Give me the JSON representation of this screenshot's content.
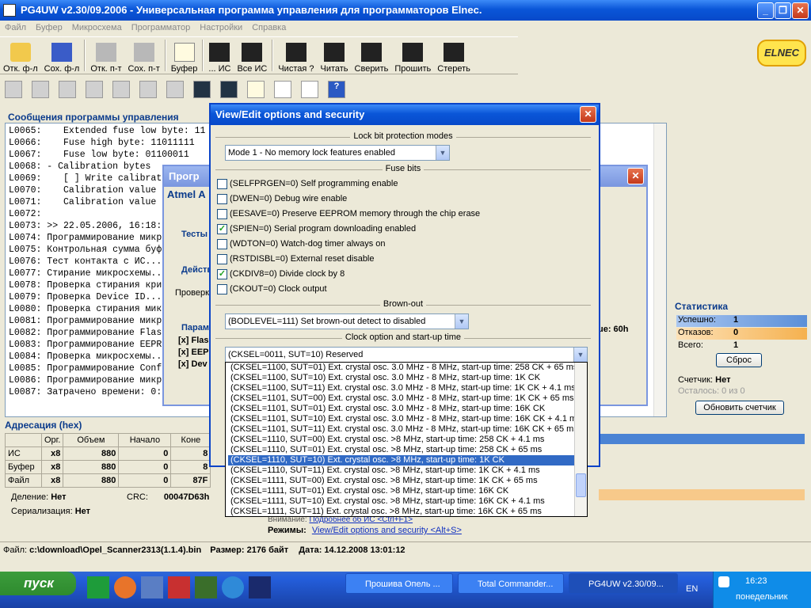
{
  "app": {
    "title": "PG4UW v2.30/09.2006 - Универсальная программа управления для программаторов Elnec.",
    "logo": "ELNEC"
  },
  "menu": [
    "Файл",
    "Буфер",
    "Микросхема",
    "Программатор",
    "Настройки",
    "Справка"
  ],
  "toolbar": [
    "Отк. ф-л",
    "Сох. ф-л",
    "Отк. п-т",
    "Сох. п-т",
    "Буфер",
    "... ИС",
    "Все ИС",
    "Чистая ?",
    "Читать",
    "Сверить",
    "Прошить",
    "Стереть"
  ],
  "log_panel": {
    "title": "Сообщения программы управления",
    "lines": [
      "L0065:    Extended fuse low byte: 11",
      "L0066:    Fuse high byte: 11011111",
      "L0067:    Fuse low byte: 01100011",
      "L0068: - Calibration bytes",
      "L0069:    [ ] Write calibrat",
      "L0070:    Calibration value",
      "L0071:    Calibration value",
      "L0072:",
      "L0073: >> 22.05.2006, 16:18:",
      "L0074: Программирование микр",
      "L0075: Контрольная сумма буф",
      "L0076: Тест контакта с ИС...",
      "L0077: Стирание микросхемы..",
      "L0078: Проверка стирания кри",
      "L0079: Проверка Device ID...",
      "L0080: Проверка стирания микр",
      "L0081: Программирование микр",
      "L0082: Программирование Flas",
      "L0083: Программирование EEPR",
      "L0084: Проверка микросхемы..",
      "L0085: Программирование Conf",
      "L0086: Программирование микр",
      "L0087: Затрачено времени: 0:"
    ]
  },
  "back_dialog": {
    "title": "Прогр",
    "header": "Atmel A",
    "group1": "Тесты",
    "group2": "Действ",
    "text": "Проверк",
    "group3": "Парам",
    "items": [
      "[x] Flas",
      "[x] EEP",
      "[x] Dev"
    ],
    "right_text": "ue: 60h"
  },
  "address": {
    "title": "Адресация (hex)",
    "headers": [
      "",
      "Орг.",
      "Объем",
      "Начало",
      "Коне"
    ],
    "rows": [
      [
        "ИС",
        "x8",
        "880",
        "0",
        "8"
      ],
      [
        "Буфер",
        "x8",
        "880",
        "0",
        "8"
      ],
      [
        "Файл",
        "x8",
        "880",
        "0",
        "87F"
      ]
    ],
    "division_label": "Деление:",
    "division": "Нет",
    "crc_label": "CRC:",
    "crc": "00047D63h",
    "serial_label": "Сериализация:",
    "serial": "Нет"
  },
  "stats": {
    "title": "Статистика",
    "success_label": "Успешно:",
    "success": "1",
    "fail_label": "Отказов:",
    "fail": "0",
    "total_label": "Всего:",
    "total": "1",
    "reset": "Сброс",
    "counter_label": "Счетчик:",
    "counter": "Нет",
    "remain_label": "Осталось:",
    "remain": "0 из 0",
    "update": "Обновить счетчик"
  },
  "bottom_info": {
    "attention": "Внимание:",
    "attention_link": "Подробнее об ИС <Ctrl+F1>",
    "modes": "Режимы:",
    "modes_link": "View/Edit options and security <Alt+S>"
  },
  "status": {
    "file_label": "Файл:",
    "file": "c:\\download\\Opel_Scanner2313(1.1.4).bin",
    "size": "Размер: 2176 байт",
    "date": "Дата: 14.12.2008 13:01:12"
  },
  "dialog": {
    "title": "View/Edit options and security",
    "lock_title": "Lock bit protection modes",
    "lock_value": "Mode 1 - No memory lock features enabled",
    "fuse_title": "Fuse bits",
    "fuses": [
      {
        "label": "(SELFPRGEN=0) Self programming enable",
        "checked": false
      },
      {
        "label": "(DWEN=0) Debug wire enable",
        "checked": false
      },
      {
        "label": "(EESAVE=0) Preserve EEPROM memory through the chip erase",
        "checked": false
      },
      {
        "label": "(SPIEN=0) Serial program downloading enabled",
        "checked": true
      },
      {
        "label": "(WDTON=0) Watch-dog timer always on",
        "checked": false
      },
      {
        "label": "(RSTDISBL=0) External reset disable",
        "checked": false
      },
      {
        "label": "(CKDIV8=0) Divide clock by 8",
        "checked": true
      },
      {
        "label": "(CKOUT=0) Clock output",
        "checked": false
      }
    ],
    "brownout_title": "Brown-out",
    "brownout_value": "(BODLEVEL=111) Set brown-out detect to disabled",
    "clock_title": "Clock option and start-up time",
    "clock_value": "(CKSEL=0011, SUT=10) Reserved",
    "clock_options": [
      "(CKSEL=1100, SUT=01) Ext. crystal osc. 3.0 MHz - 8 MHz, start-up time: 258 CK + 65 ms",
      "(CKSEL=1100, SUT=10) Ext. crystal osc. 3.0 MHz - 8 MHz, start-up time: 1K CK",
      "(CKSEL=1100, SUT=11) Ext. crystal osc. 3.0 MHz - 8 MHz, start-up time: 1K CK + 4.1 ms",
      "(CKSEL=1101, SUT=00) Ext. crystal osc. 3.0 MHz - 8 MHz, start-up time: 1K CK + 65 ms",
      "(CKSEL=1101, SUT=01) Ext. crystal osc. 3.0 MHz - 8 MHz, start-up time: 16K CK",
      "(CKSEL=1101, SUT=10) Ext. crystal osc. 3.0 MHz - 8 MHz, start-up time: 16K CK + 4.1 ms",
      "(CKSEL=1101, SUT=11) Ext. crystal osc. 3.0 MHz - 8 MHz, start-up time: 16K CK + 65 ms",
      "(CKSEL=1110, SUT=00) Ext. crystal osc. >8 MHz, start-up time: 258 CK + 4.1 ms",
      "(CKSEL=1110, SUT=01) Ext. crystal osc. >8 MHz, start-up time: 258 CK + 65 ms",
      "(CKSEL=1110, SUT=10) Ext. crystal osc. >8 MHz, start-up time: 1K CK",
      "(CKSEL=1110, SUT=11) Ext. crystal osc. >8 MHz, start-up time: 1K CK + 4.1 ms",
      "(CKSEL=1111, SUT=00) Ext. crystal osc. >8 MHz, start-up time: 1K CK + 65 ms",
      "(CKSEL=1111, SUT=01) Ext. crystal osc. >8 MHz, start-up time: 16K CK",
      "(CKSEL=1111, SUT=10) Ext. crystal osc. >8 MHz, start-up time: 16K CK + 4.1 ms",
      "(CKSEL=1111, SUT=11) Ext. crystal osc. >8 MHz, start-up time: 16K CK + 65 ms"
    ],
    "selected_index": 9
  },
  "taskbar": {
    "start": "пуск",
    "tasks": [
      "Прошива Опель ...",
      "Total Commander...",
      "PG4UW v2.30/09..."
    ],
    "lang": "EN",
    "time": "16:23",
    "day": "понедельник"
  }
}
